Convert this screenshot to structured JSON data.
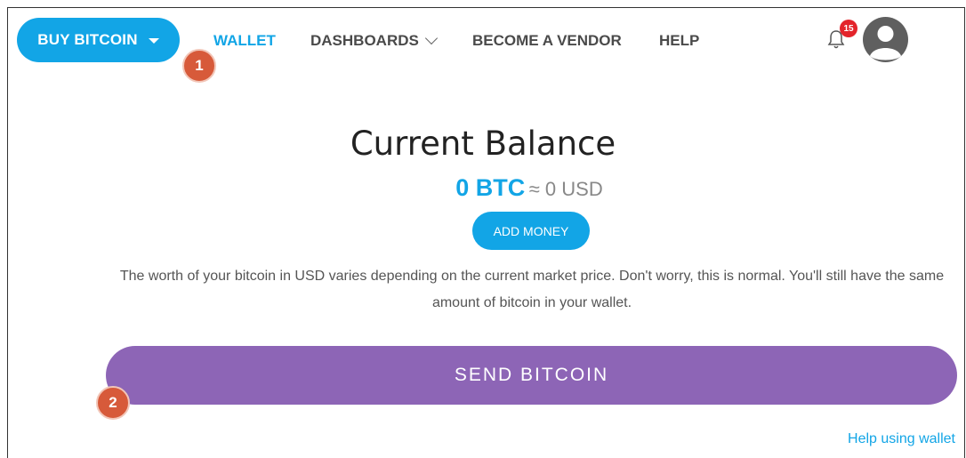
{
  "nav": {
    "buy_label": "BUY BITCOIN",
    "wallet": "WALLET",
    "dashboards": "DASHBOARDS",
    "vendor": "BECOME A VENDOR",
    "help": "HELP",
    "notification_count": "15"
  },
  "steps": {
    "one": "1",
    "two": "2"
  },
  "balance": {
    "title": "Current Balance",
    "btc": "0 BTC",
    "usd": "≈ 0 USD",
    "add_money": "ADD MONEY"
  },
  "note": "The worth of your bitcoin in USD varies depending on the current market price. Don't worry, this is normal. You'll still have the same amount of bitcoin in your wallet.",
  "send_label": "SEND BITCOIN",
  "help_wallet": "Help using wallet",
  "colors": {
    "accent": "#12a5e6",
    "send": "#8d65b6",
    "marker": "#d75a3a",
    "badge": "#e3242b"
  }
}
